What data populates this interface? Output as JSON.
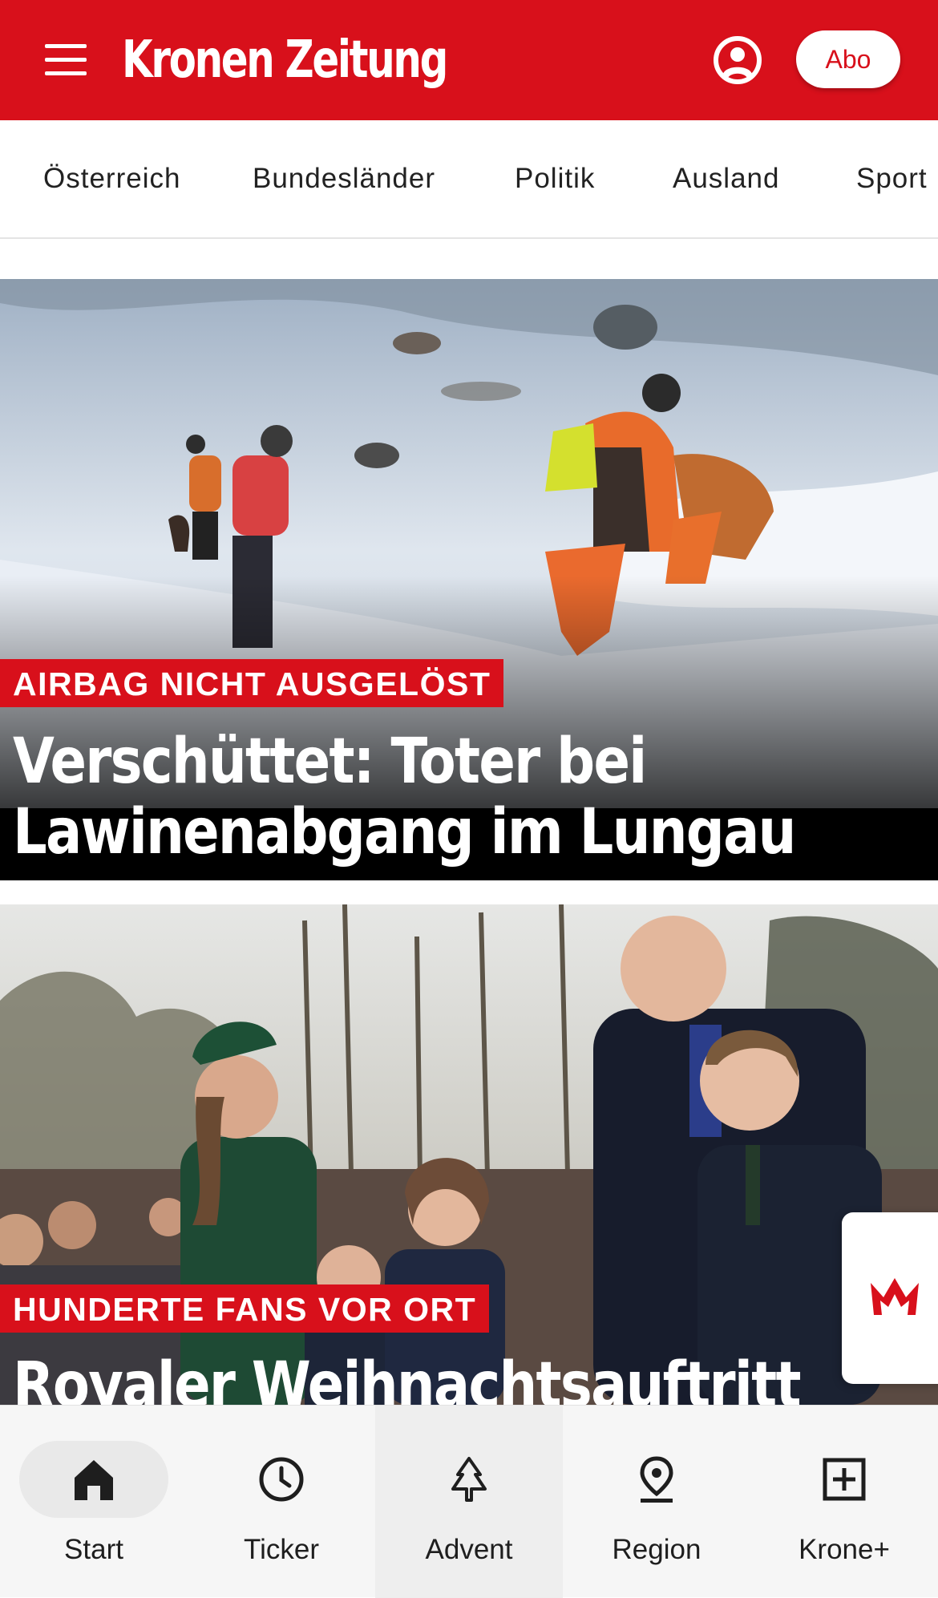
{
  "header": {
    "logo_text": "Kronen Zeitung",
    "abo_label": "Abo",
    "brand_color": "#d8101b",
    "menu_icon": "hamburger-menu-icon",
    "account_icon": "user-circle-icon"
  },
  "categories": [
    "Österreich",
    "Bundesländer",
    "Politik",
    "Ausland",
    "Sport"
  ],
  "articles": [
    {
      "kicker": "AIRBAG NICHT AUSGELÖST",
      "headline_line1": "Verschüttet: Toter bei",
      "headline_line2": "Lawinenabgang im Lungau",
      "image": "avalanche-rescue-photo"
    },
    {
      "kicker": "HUNDERTE FANS VOR ORT",
      "headline_line1": "Royaler Weihnachtsauftritt",
      "image": "royal-family-photo"
    }
  ],
  "floating_button": {
    "icon": "crown-icon"
  },
  "bottom_nav": [
    {
      "label": "Start",
      "icon": "home-icon",
      "active": true
    },
    {
      "label": "Ticker",
      "icon": "clock-icon"
    },
    {
      "label": "Advent",
      "icon": "tree-icon"
    },
    {
      "label": "Region",
      "icon": "location-pin-icon"
    },
    {
      "label": "Krone+",
      "icon": "plus-box-icon"
    }
  ]
}
